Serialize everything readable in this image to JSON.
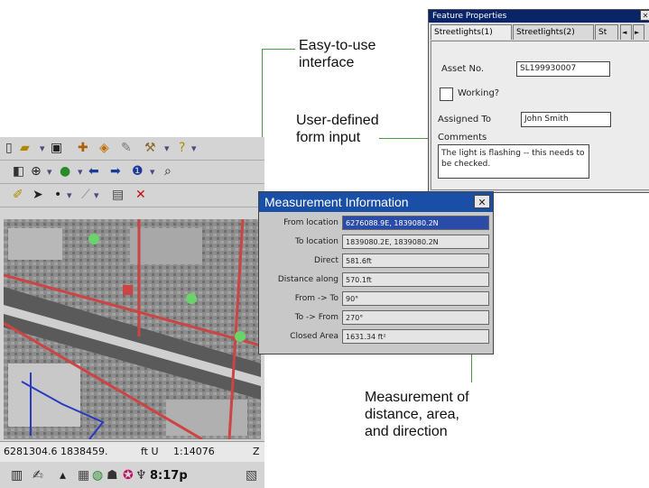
{
  "callouts": {
    "easy": "Easy-to-use\ninterface",
    "form": "User-defined\nform input",
    "measure": "Measurement of\ndistance, area,\nand direction"
  },
  "feature_properties": {
    "title": "Feature Properties",
    "close_glyph": "✕",
    "tabs": [
      "Streetlights(1)",
      "Streetlights(2)",
      "St"
    ],
    "tab_prev": "◄",
    "tab_next": "►",
    "asset_label": "Asset No.",
    "asset_value": "SL199930007",
    "working_label": "Working?",
    "assigned_label": "Assigned To",
    "assigned_value": "John Smith",
    "comments_label": "Comments",
    "comments_value": "The light is flashing -- this needs to be checked."
  },
  "device": {
    "toolbar_icons": {
      "row1": [
        "new-icon",
        "open-icon",
        "save-icon",
        "add-data-icon",
        "layers-icon",
        "identify-icon",
        "tools-icon",
        "help-icon"
      ],
      "row2": [
        "pan-icon",
        "zoom-icon",
        "globe-icon",
        "back-icon",
        "forward-icon",
        "info-icon",
        "find-icon"
      ],
      "row3": [
        "edit-icon",
        "select-icon",
        "dot-icon",
        "sketch-icon",
        "properties-icon",
        "delete-icon"
      ]
    },
    "status": {
      "coords": "6281304.6 1838459.",
      "units": "ft U",
      "scale": "1:14076",
      "z": "Z"
    },
    "taskbar": {
      "time": "8:17p"
    }
  },
  "measurement": {
    "title": "Measurement Information",
    "close_glyph": "✕",
    "rows": [
      {
        "label": "From location",
        "value": "6276088.9E, 1839080.2N"
      },
      {
        "label": "To location",
        "value": "1839080.2E, 1839080.2N"
      },
      {
        "label": "Direct",
        "value": "581.6ft"
      },
      {
        "label": "Distance along",
        "value": "570.1ft"
      },
      {
        "label": "From -> To",
        "value": "90°"
      },
      {
        "label": "To -> From",
        "value": "270°"
      },
      {
        "label": "Closed Area",
        "value": "1631.34 ft²"
      }
    ]
  }
}
